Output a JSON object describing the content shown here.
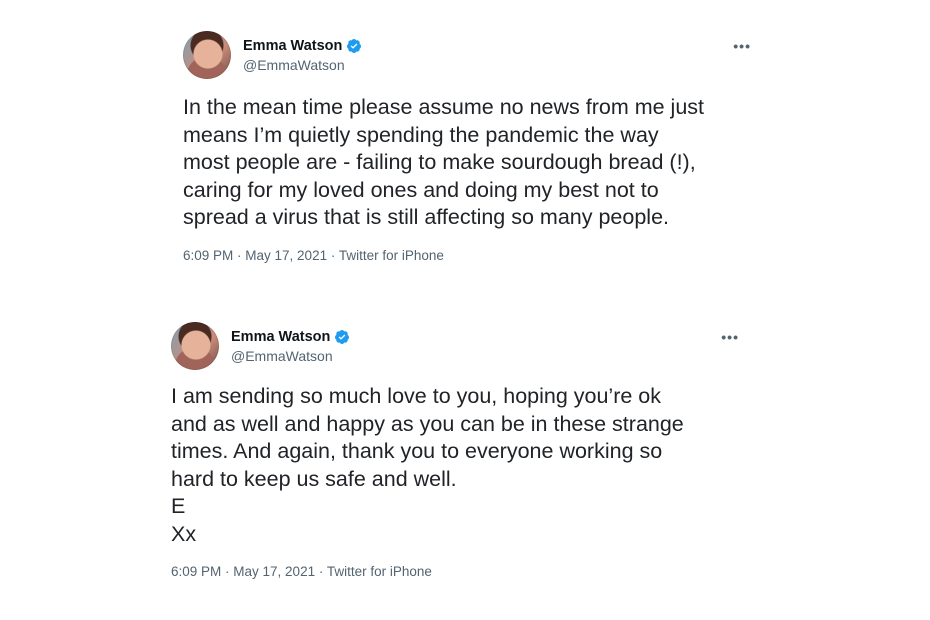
{
  "tweets": [
    {
      "author": {
        "name": "Emma Watson",
        "handle": "@EmmaWatson",
        "verified": true
      },
      "more_icon": "more-horizontal-icon",
      "text": "In the mean time please assume no news from me just\nmeans I’m quietly spending the pandemic the way\nmost people are - failing to make sourdough bread (!),\ncaring for my loved ones and doing my best not to\nspread a virus that is still affecting so many people.",
      "meta": {
        "time": "6:09 PM",
        "sep1": " · ",
        "date": "May 17, 2021",
        "sep2": " · ",
        "source": "Twitter for iPhone"
      }
    },
    {
      "author": {
        "name": "Emma Watson",
        "handle": "@EmmaWatson",
        "verified": true
      },
      "more_icon": "more-horizontal-icon",
      "text": "I am sending so much love to you, hoping you’re ok\nand as well and happy as you can be in these strange\ntimes. And again, thank you to everyone working so\nhard to keep us safe and well.\nE\nXx",
      "meta": {
        "time": "6:09 PM",
        "sep1": " · ",
        "date": "May 17, 2021",
        "sep2": " · ",
        "source": "Twitter for iPhone"
      }
    }
  ],
  "colors": {
    "verified": "#1d9bf0",
    "secondary_text": "#536471",
    "body_text": "#202327"
  }
}
